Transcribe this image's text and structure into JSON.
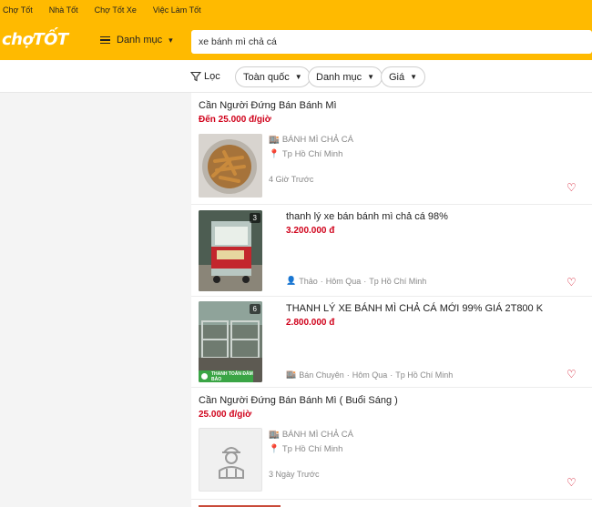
{
  "nav": {
    "links": [
      "Chợ Tốt",
      "Nhà Tốt",
      "Chợ Tốt Xe",
      "Việc Làm Tốt"
    ],
    "logo": "chợTỐT",
    "menu_label": "Danh mục"
  },
  "search": {
    "value": "xe bánh mì chả cá"
  },
  "filters": {
    "filter_label": "Lọc",
    "location": "Toàn quốc",
    "category": "Danh mục",
    "price": "Giá"
  },
  "listings": [
    {
      "title": "Cần Người Đứng Bán Bánh Mì",
      "price": "Đến 25.000 đ/giờ",
      "shop": "BÁNH MÌ CHẢ CÁ",
      "location": "Tp Hồ Chí Minh",
      "time": "4 Giờ Trước"
    },
    {
      "title": "thanh lý xe bán bánh mì chả cá 98%",
      "price": "3.200.000 đ",
      "image_count": "3",
      "seller": "Thảo",
      "time": "Hôm Qua",
      "location": "Tp Hồ Chí Minh"
    },
    {
      "title": "THANH LÝ XE BÁNH MÌ CHẢ CÁ MỚI 99% GIÁ 2T800 K",
      "price": "2.800.000 đ",
      "image_count": "6",
      "badge": "THANH TOÁN ĐẢM BẢO",
      "seller": "Bán Chuyên",
      "time": "Hôm Qua",
      "location": "Tp Hồ Chí Minh"
    },
    {
      "title": "Cần Người Đứng Bán Bánh Mì ( Buổi Sáng )",
      "price": "25.000 đ/giờ",
      "shop": "BÁNH MÌ CHẢ CÁ",
      "location": "Tp Hồ Chí Minh",
      "time": "3 Ngày Trước"
    }
  ],
  "colors": {
    "brand": "#ffba00",
    "price": "#d0021b",
    "badge": "#3aa545"
  }
}
